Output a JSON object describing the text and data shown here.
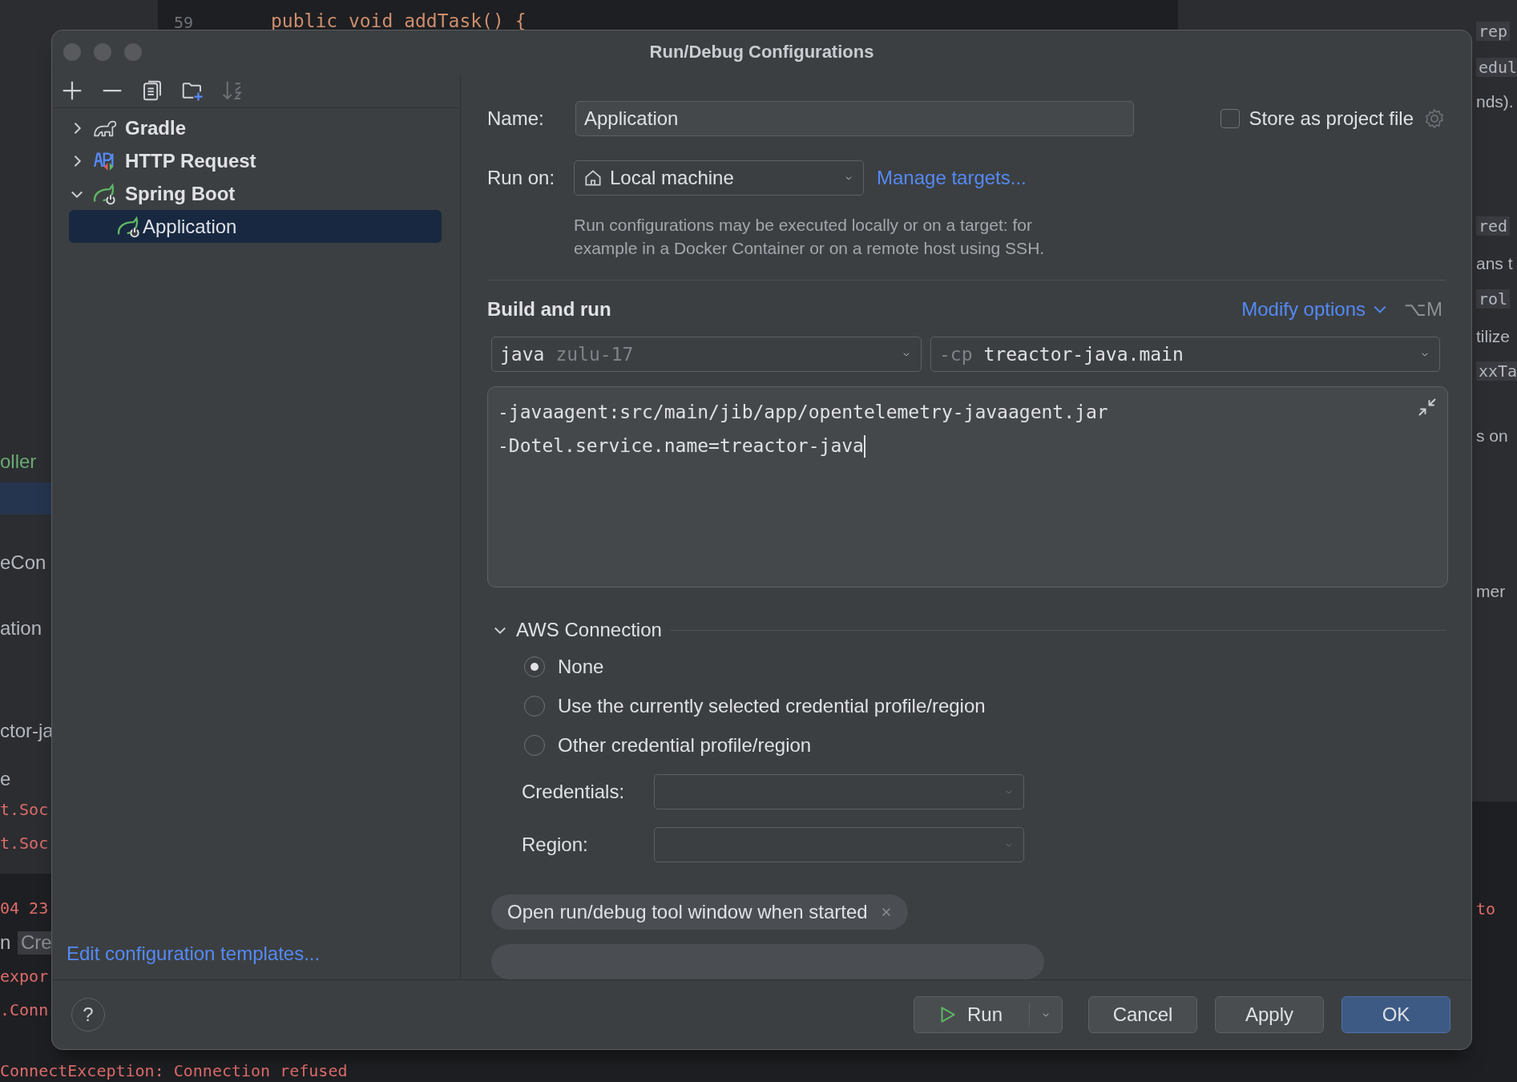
{
  "background": {
    "line_number": "59",
    "code_line": "public void addTask() {",
    "left_fragments": [
      {
        "text": "oller",
        "kind": "green"
      },
      {
        "text": "eCon",
        "kind": "plain"
      },
      {
        "text": "ation",
        "kind": "plain"
      },
      {
        "text": "ctor-ja",
        "kind": "plain"
      },
      {
        "text": "e",
        "kind": "plain"
      },
      {
        "text": "t.Soc",
        "kind": "error"
      },
      {
        "text": "t.Soc",
        "kind": "error"
      },
      {
        "text": "04 23",
        "kind": "error"
      },
      {
        "text": "n",
        "kind": "plain"
      },
      {
        "text": "Cre",
        "kind": "chip"
      },
      {
        "text": "expor",
        "kind": "error"
      },
      {
        "text": ".Conn",
        "kind": "error"
      }
    ],
    "right_fragments": [
      {
        "text": "rep",
        "kind": "code"
      },
      {
        "text": "edul",
        "kind": "code"
      },
      {
        "text": "nds).",
        "kind": "plain"
      },
      {
        "text": "red",
        "kind": "code"
      },
      {
        "text": "ans t",
        "kind": "plain"
      },
      {
        "text": "rol",
        "kind": "code"
      },
      {
        "text": "tilize",
        "kind": "plain"
      },
      {
        "text": "xxTa",
        "kind": "code"
      },
      {
        "text": "s on",
        "kind": "plain"
      },
      {
        "text": "mer",
        "kind": "plain"
      },
      {
        "text": "to",
        "kind": "error"
      }
    ],
    "bottom_line": "ConnectException: Connection refused"
  },
  "dialog": {
    "title": "Run/Debug Configurations",
    "tree": [
      {
        "label": "Gradle",
        "kind": "gradle",
        "expanded": false,
        "selected": false
      },
      {
        "label": "HTTP Request",
        "kind": "http",
        "expanded": false,
        "selected": false
      },
      {
        "label": "Spring Boot",
        "kind": "spring",
        "expanded": true,
        "selected": false,
        "children": [
          {
            "label": "Application",
            "kind": "spring",
            "selected": true
          }
        ]
      }
    ],
    "templates_link": "Edit configuration templates...",
    "help": "?",
    "name": {
      "label": "Name:",
      "value": "Application"
    },
    "store_as_project_file": {
      "label": "Store as project file",
      "checked": false
    },
    "run_on": {
      "label": "Run on:",
      "value": "Local machine",
      "link": "Manage targets..."
    },
    "run_on_hint": [
      "Run configurations may be executed locally or on a target: for",
      "example in a Docker Container or on a remote host using SSH."
    ],
    "build_and_run": {
      "title": "Build and run",
      "modify_options": "Modify options",
      "shortcut": "⌥M",
      "jdk": {
        "keyword": "java",
        "version": "zulu-17"
      },
      "classpath": {
        "flag": "-cp",
        "module": "treactor-java.main"
      },
      "vm_options": [
        "-javaagent:src/main/jib/app/opentelemetry-javaagent.jar",
        "-Dotel.service.name=treactor-java"
      ]
    },
    "aws": {
      "title": "AWS Connection",
      "expanded": true,
      "options": [
        {
          "label": "None",
          "selected": true
        },
        {
          "label": "Use the currently selected credential profile/region",
          "selected": false
        },
        {
          "label": "Other credential profile/region",
          "selected": false
        }
      ],
      "credentials_label": "Credentials:",
      "region_label": "Region:"
    },
    "chips": [
      {
        "label": "Open run/debug tool window when started"
      }
    ],
    "buttons": [
      {
        "label": "Run",
        "kind": "split"
      },
      {
        "label": "Cancel",
        "kind": "plain"
      },
      {
        "label": "Apply",
        "kind": "plain"
      },
      {
        "label": "OK",
        "kind": "default"
      }
    ]
  }
}
